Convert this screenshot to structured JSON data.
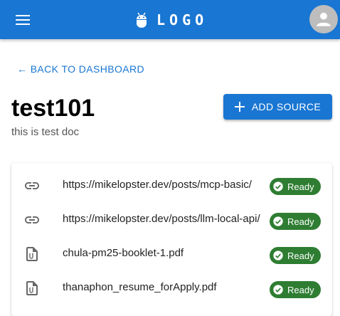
{
  "header": {
    "logo_text": "LOGO",
    "menu_icon": "hamburger-menu-icon",
    "logo_icon": "android-icon",
    "avatar_icon": "person-icon",
    "bar_color": "#1976d2"
  },
  "nav": {
    "back_label": "← BACK TO DASHBOARD"
  },
  "document": {
    "title": "test101",
    "description": "this is test doc"
  },
  "actions": {
    "add_source_label": "ADD SOURCE",
    "add_icon": "plus-icon"
  },
  "sources": [
    {
      "name": "https://mikelopster.dev/posts/mcp-basic/",
      "type_icon": "link-icon",
      "status": "Ready"
    },
    {
      "name": "https://mikelopster.dev/posts/llm-local-api/",
      "type_icon": "link-icon",
      "status": "Ready"
    },
    {
      "name": "chula-pm25-booklet-1.pdf",
      "type_icon": "file-icon",
      "status": "Ready"
    },
    {
      "name": "thanaphon_resume_forApply.pdf",
      "type_icon": "file-icon",
      "status": "Ready"
    }
  ],
  "colors": {
    "accent": "#1976d2",
    "ready": "#2e7d32"
  }
}
